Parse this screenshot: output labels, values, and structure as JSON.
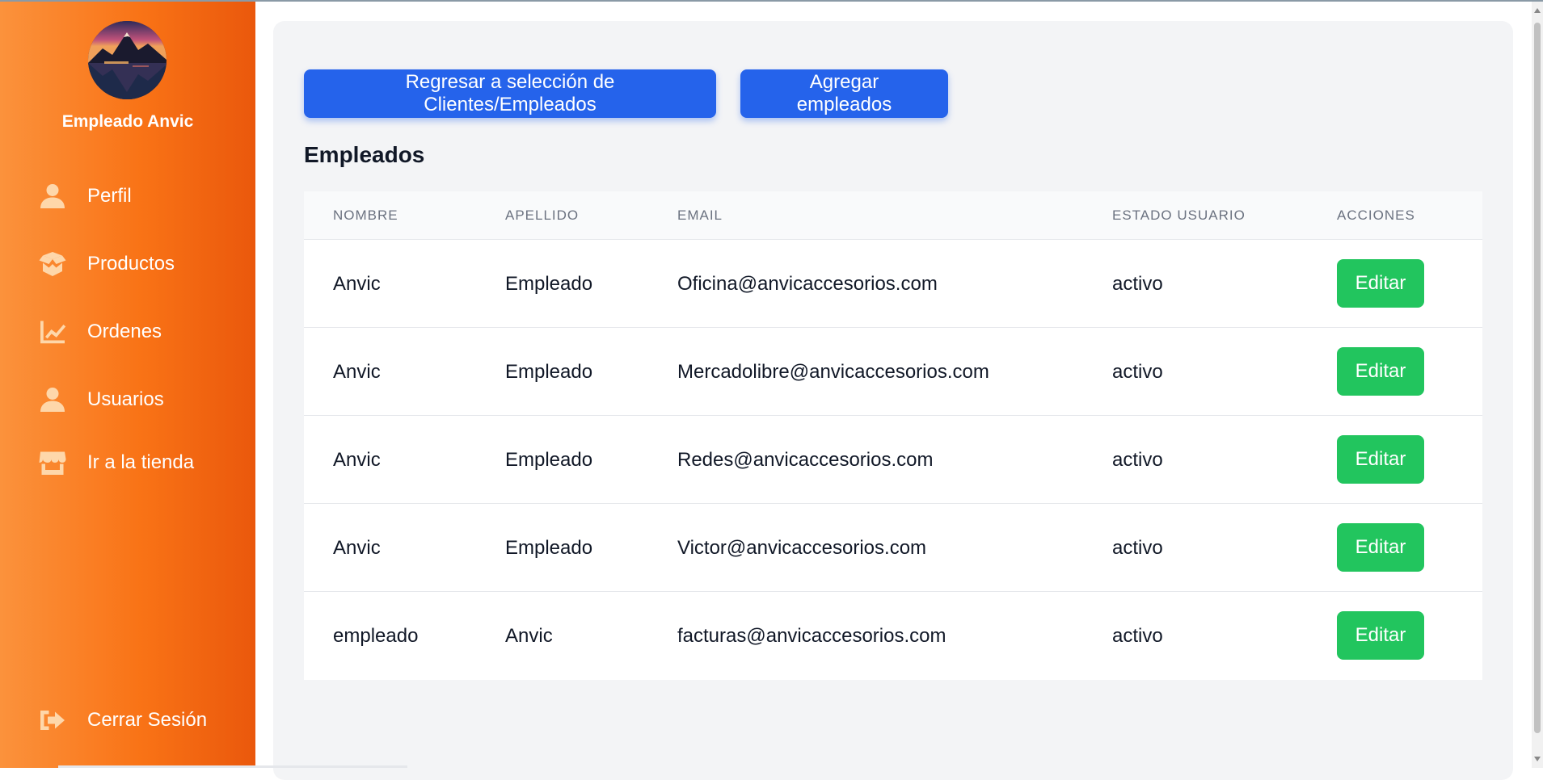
{
  "sidebar": {
    "user_name": "Empleado Anvic",
    "avatar_icon": "mountain-lake-avatar",
    "items": [
      {
        "label": "Perfil",
        "icon": "user-icon"
      },
      {
        "label": "Productos",
        "icon": "box-open-icon"
      },
      {
        "label": "Ordenes",
        "icon": "chart-line-icon"
      },
      {
        "label": "Usuarios",
        "icon": "user-icon"
      },
      {
        "label": "Ir a la tienda",
        "icon": "store-icon"
      }
    ],
    "logout": {
      "label": "Cerrar Sesión",
      "icon": "sign-out-icon"
    }
  },
  "main": {
    "back_button": "Regresar a selección de Clientes/Empleados",
    "add_button": "Agregar empleados",
    "section_title": "Empleados",
    "table": {
      "headers": [
        "NOMBRE",
        "APELLIDO",
        "EMAIL",
        "ESTADO USUARIO",
        "ACCIONES"
      ],
      "rows": [
        {
          "nombre": "Anvic",
          "apellido": "Empleado",
          "email": "Oficina@anvicaccesorios.com",
          "estado": "activo",
          "accion": "Editar"
        },
        {
          "nombre": "Anvic",
          "apellido": "Empleado",
          "email": "Mercadolibre@anvicaccesorios.com",
          "estado": "activo",
          "accion": "Editar"
        },
        {
          "nombre": "Anvic",
          "apellido": "Empleado",
          "email": "Redes@anvicaccesorios.com",
          "estado": "activo",
          "accion": "Editar"
        },
        {
          "nombre": "Anvic",
          "apellido": "Empleado",
          "email": "Victor@anvicaccesorios.com",
          "estado": "activo",
          "accion": "Editar"
        },
        {
          "nombre": "empleado",
          "apellido": "Anvic",
          "email": "facturas@anvicaccesorios.com",
          "estado": "activo",
          "accion": "Editar"
        }
      ]
    }
  },
  "colors": {
    "sidebar_start": "#fb923c",
    "sidebar_end": "#ea580c",
    "primary_button": "#2563eb",
    "edit_button": "#22c55e",
    "content_bg": "#f3f4f6"
  }
}
